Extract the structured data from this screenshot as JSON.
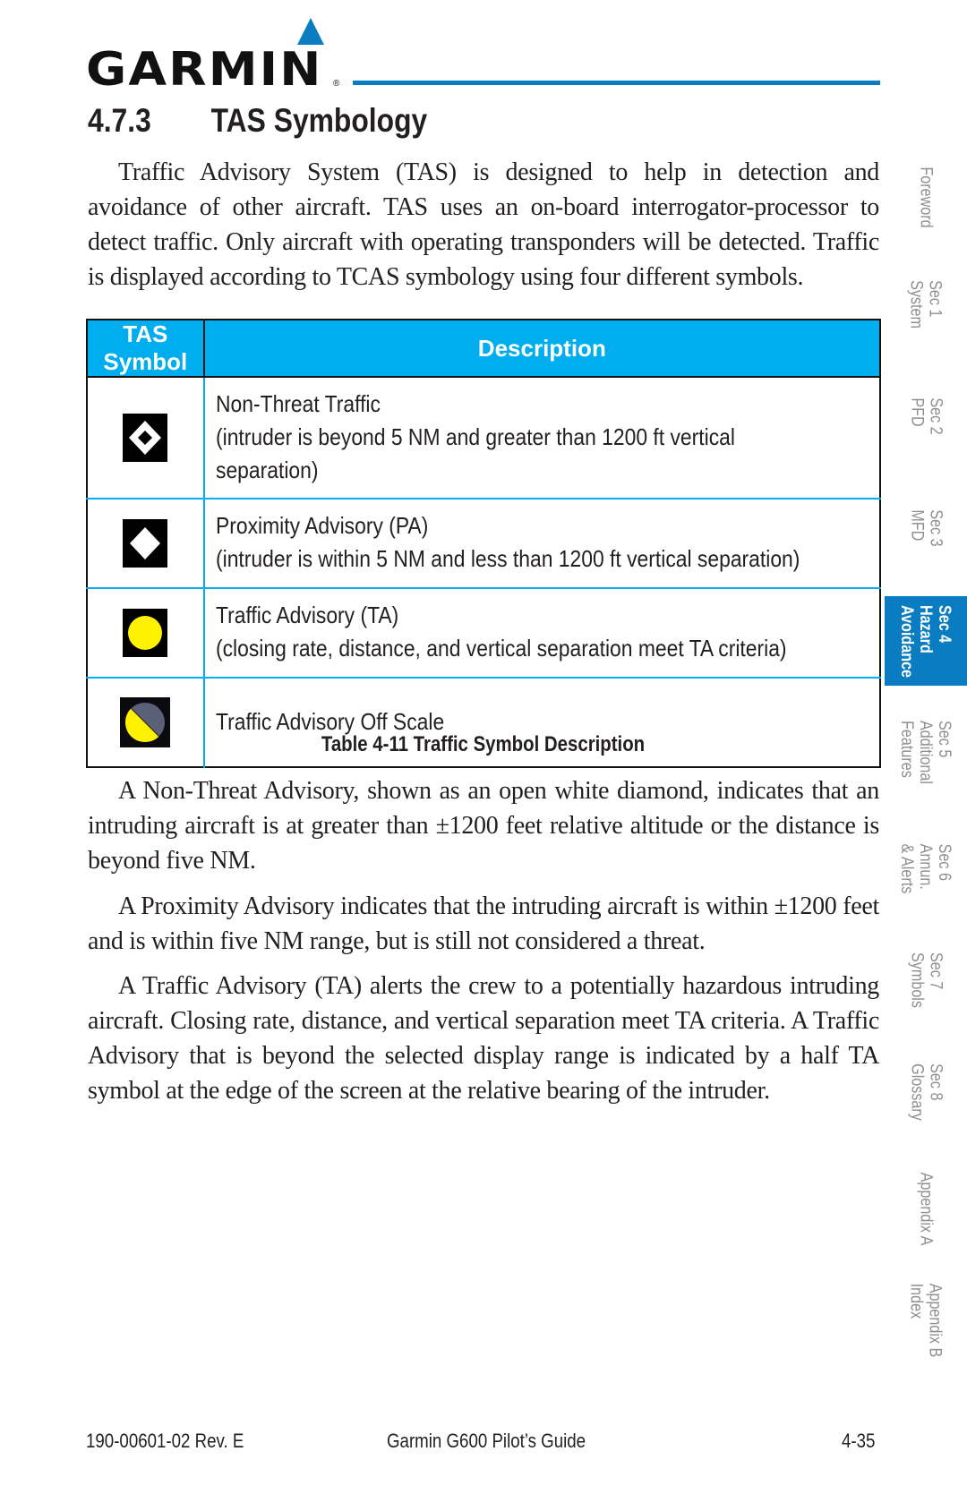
{
  "header": {
    "brand": "GARMIN",
    "brand_mark": "®",
    "section_number": "4.7.3",
    "section_title": "TAS Symbology",
    "accent_color": "#0a7cc1"
  },
  "intro_paragraph": "Traffic Advisory System (TAS) is designed to help in detection and avoidance of other aircraft. TAS uses an on-board interrogator-processor to detect traffic. Only aircraft with operating transponders will be detected. Traffic is displayed according to TCAS symbology using four different symbols.",
  "table": {
    "header_color": "#00adef",
    "columns": [
      "TAS Symbol",
      "Description"
    ],
    "rows": [
      {
        "symbol_icon": "non-threat-traffic-open-diamond-icon",
        "title": "Non-Threat Traffic",
        "detail": "(intruder is beyond 5 NM and greater than 1200 ft vertical separation)"
      },
      {
        "symbol_icon": "proximity-advisory-filled-diamond-icon",
        "title": "Proximity Advisory (PA)",
        "detail": "(intruder is within 5 NM and less than 1200 ft vertical separation)"
      },
      {
        "symbol_icon": "traffic-advisory-yellow-circle-icon",
        "title": "Traffic Advisory (TA)",
        "detail": "(closing rate, distance, and vertical separation meet TA criteria)"
      },
      {
        "symbol_icon": "traffic-advisory-off-scale-half-circle-icon",
        "title": "Traffic Advisory Off Scale",
        "detail": ""
      }
    ],
    "caption": "Table 4-11  Traffic Symbol Description"
  },
  "paragraphs": [
    "A Non-Threat Advisory, shown as an open white diamond, indicates that an intruding aircraft is at greater than ±1200 feet relative altitude or the distance is beyond five NM.",
    "A Proximity Advisory indicates that the intruding aircraft is within ±1200 feet and is within five NM range, but is still not considered a threat.",
    "A Traffic Advisory (TA) alerts the crew to a potentially hazardous intruding aircraft. Closing rate, distance, and vertical separation meet TA criteria. A Traffic Advisory that is beyond the selected display range is indicated by a half TA symbol at the edge of the screen at the relative bearing of the intruder."
  ],
  "side_tabs": [
    {
      "line1": "Foreword",
      "line2": "",
      "active": false
    },
    {
      "line1": "Sec 1",
      "line2": "System",
      "active": false
    },
    {
      "line1": "Sec 2",
      "line2": "PFD",
      "active": false
    },
    {
      "line1": "Sec 3",
      "line2": "MFD",
      "active": false
    },
    {
      "line1": "Sec 4",
      "line2": "Hazard",
      "line3": "Avoidance",
      "active": true
    },
    {
      "line1": "Sec 5",
      "line2": "Additional",
      "line3": "Features",
      "active": false
    },
    {
      "line1": "Sec 6",
      "line2": "Annun.",
      "line3": "& Alerts",
      "active": false
    },
    {
      "line1": "Sec 7",
      "line2": "Symbols",
      "active": false
    },
    {
      "line1": "Sec 8",
      "line2": "Glossary",
      "active": false
    },
    {
      "line1": "Appendix A",
      "line2": "",
      "active": false
    },
    {
      "line1": "Appendix B",
      "line2": "Index",
      "active": false
    }
  ],
  "footer": {
    "doc_number": "190-00601-02  Rev. E",
    "title": "Garmin G600 Pilot’s Guide",
    "page": "4-35"
  },
  "symbol_colors": {
    "ta_yellow": "#fff200",
    "off_scale_gray": "#5a6078",
    "background": "#000000",
    "diamond": "#ffffff"
  }
}
